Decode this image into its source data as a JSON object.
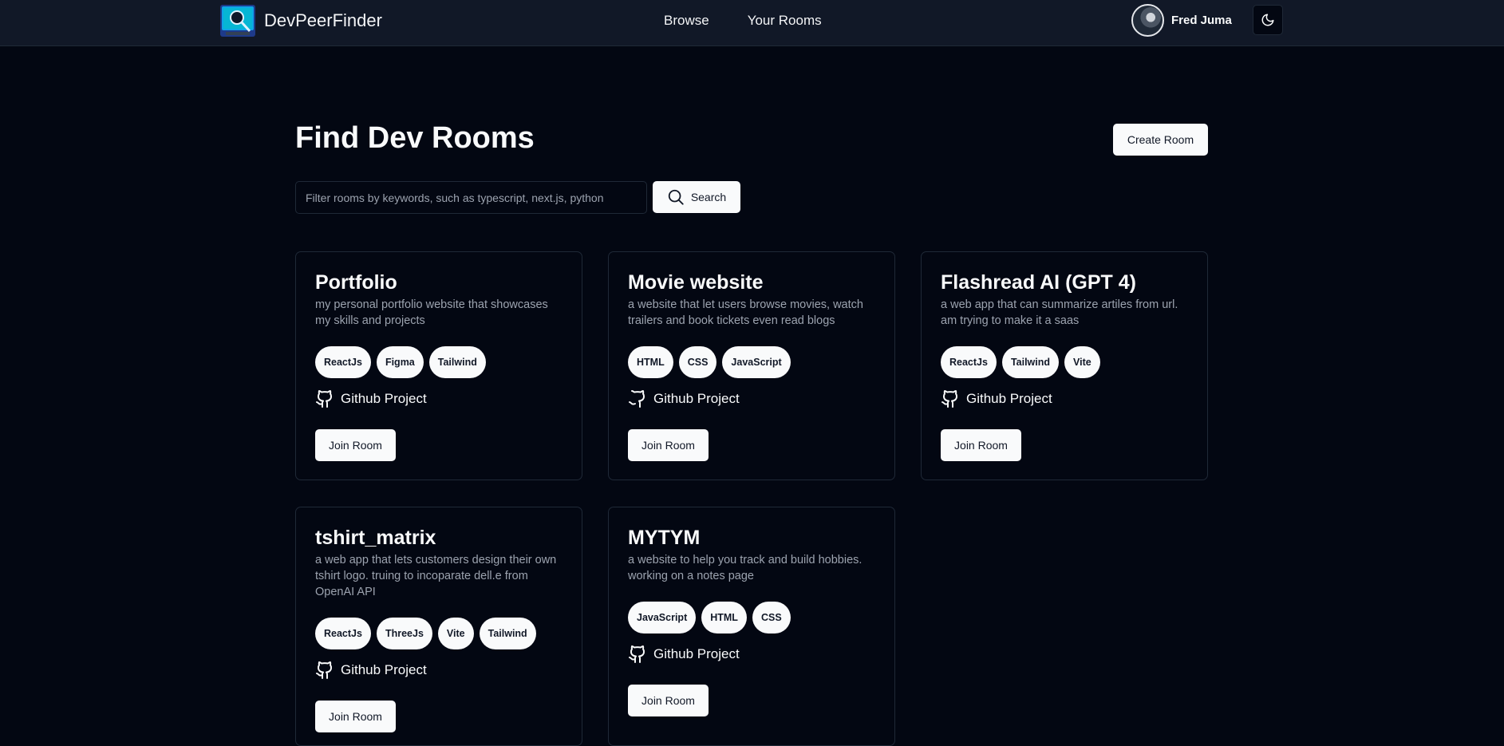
{
  "header": {
    "app_name": "DevPeerFinder",
    "nav": [
      "Browse",
      "Your Rooms"
    ],
    "user_name": "Fred Juma"
  },
  "main": {
    "title": "Find Dev Rooms",
    "create_label": "Create Room",
    "search_placeholder": "Filter rooms by keywords, such as typescript, next.js, python",
    "search_label": "Search"
  },
  "rooms": [
    {
      "name": "Portfolio",
      "description": "my personal portfolio website that showcases my skills and projects",
      "tags": [
        "ReactJs",
        "Figma",
        "Tailwind"
      ],
      "github_label": "Github Project",
      "join_label": "Join Room"
    },
    {
      "name": "Movie website",
      "description": "a website that let users browse movies, watch trailers and book tickets even read blogs",
      "tags": [
        "HTML",
        "CSS",
        "JavaScript"
      ],
      "github_label": "Github Project",
      "join_label": "Join Room"
    },
    {
      "name": "Flashread AI (GPT 4)",
      "description": "a web app that can summarize artiles from url. am trying to make it a saas",
      "tags": [
        "ReactJs",
        "Tailwind",
        "Vite"
      ],
      "github_label": "Github Project",
      "join_label": "Join Room"
    },
    {
      "name": "tshirt_matrix",
      "description": "a web app that lets customers design their own tshirt logo. truing to incoparate dell.e from OpenAI API",
      "tags": [
        "ReactJs",
        "ThreeJs",
        "Vite",
        "Tailwind"
      ],
      "github_label": "Github Project",
      "join_label": "Join Room"
    },
    {
      "name": "MYTYM",
      "description": "a website to help you track and build hobbies. working on a notes page",
      "tags": [
        "JavaScript",
        "HTML",
        "CSS"
      ],
      "github_label": "Github Project",
      "join_label": "Join Room"
    }
  ]
}
